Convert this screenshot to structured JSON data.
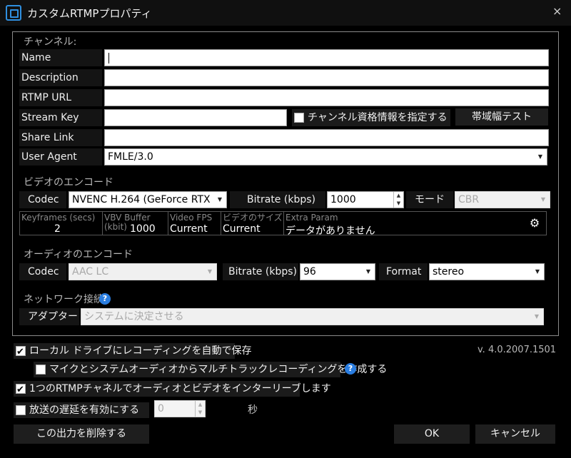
{
  "window": {
    "title": "カスタムRTMPプロパティ",
    "close_glyph": "×"
  },
  "channel": {
    "section_label": "チャンネル:",
    "name_label": "Name",
    "description_label": "Description",
    "rtmp_url_label": "RTMP URL",
    "stream_key_label": "Stream Key",
    "share_link_label": "Share Link",
    "user_agent_label": "User Agent",
    "name_value": "",
    "description_value": "",
    "rtmp_url_value": "",
    "stream_key_value": "",
    "share_link_value": "",
    "user_agent_value": "FMLE/3.0",
    "credentials_checkbox_label": "チャンネル資格情報を指定する",
    "credentials_checked": false,
    "bandwidth_test_button": "帯域幅テスト"
  },
  "video": {
    "section_label": "ビデオのエンコード",
    "codec_label": "Codec",
    "codec_value": "NVENC H.264 (GeForce RTX",
    "bitrate_label": "Bitrate (kbps)",
    "bitrate_value": "1000",
    "mode_label": "モード",
    "mode_value": "CBR",
    "grid": {
      "keyframes_header": "Keyframes (secs)",
      "keyframes_value": "2",
      "vbv_header": "VBV Buffer (kbit)",
      "vbv_value": "1000",
      "fps_header": "Video FPS",
      "fps_value": "Current",
      "size_header": "ビデオのサイズ",
      "size_value": "Current",
      "extra_header": "Extra Param",
      "extra_value": "データがありません"
    }
  },
  "audio": {
    "section_label": "オーディオのエンコード",
    "codec_label": "Codec",
    "codec_value": "AAC LC",
    "bitrate_label": "Bitrate (kbps)",
    "bitrate_value": "96",
    "format_label": "Format",
    "format_value": "stereo"
  },
  "network": {
    "section_label": "ネットワーク接続",
    "adapter_label": "アダプター",
    "adapter_value": "システムに決定させる"
  },
  "options": {
    "autosave_label": "ローカル ドライブにレコーディングを自動で保存",
    "autosave_checked": true,
    "multitrack_label": "マイクとシステムオーディオからマルチトラックレコーディングを作成する",
    "multitrack_checked": false,
    "interleave_label": "1つのRTMPチャネルでオーディオとビデオをインターリーブします",
    "interleave_checked": true,
    "delay_label": "放送の遅延を有効にする",
    "delay_checked": false,
    "delay_value": "0",
    "delay_unit": "秒",
    "version": "v. 4.0.2007.1501"
  },
  "footer": {
    "delete_button": "この出力を削除する",
    "ok_button": "OK",
    "cancel_button": "キャンセル"
  },
  "icons": {
    "help": "?",
    "gear": "⚙",
    "dropdown": "▼",
    "spin_up": "▲",
    "spin_down": "▼"
  },
  "colors": {
    "background": "#000000",
    "help_icon": "#2a7de0",
    "brand_icon": "#2f8fe0"
  }
}
